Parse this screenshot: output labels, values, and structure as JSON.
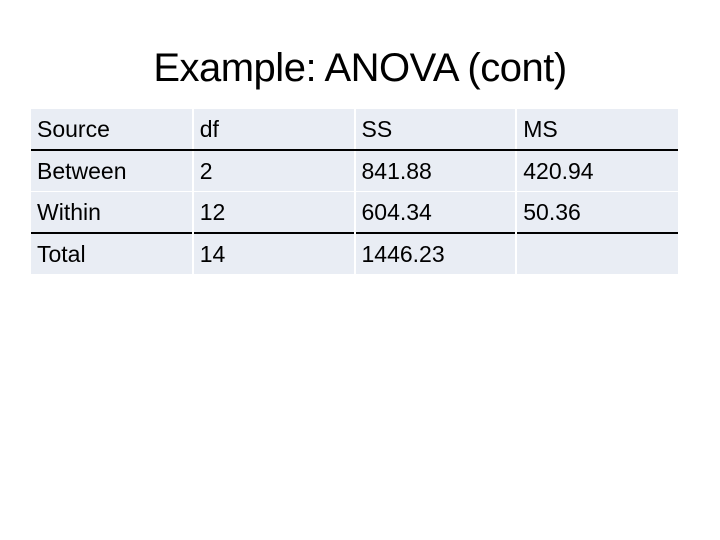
{
  "slide": {
    "title": "Example: ANOVA (cont)"
  },
  "table": {
    "headers": [
      "Source",
      "df",
      "SS",
      "MS"
    ],
    "rows": [
      [
        "Between",
        "2",
        "841.88",
        "420.94"
      ],
      [
        "Within",
        "12",
        "604.34",
        "50.36"
      ],
      [
        "Total",
        "14",
        "1446.23",
        ""
      ]
    ]
  }
}
